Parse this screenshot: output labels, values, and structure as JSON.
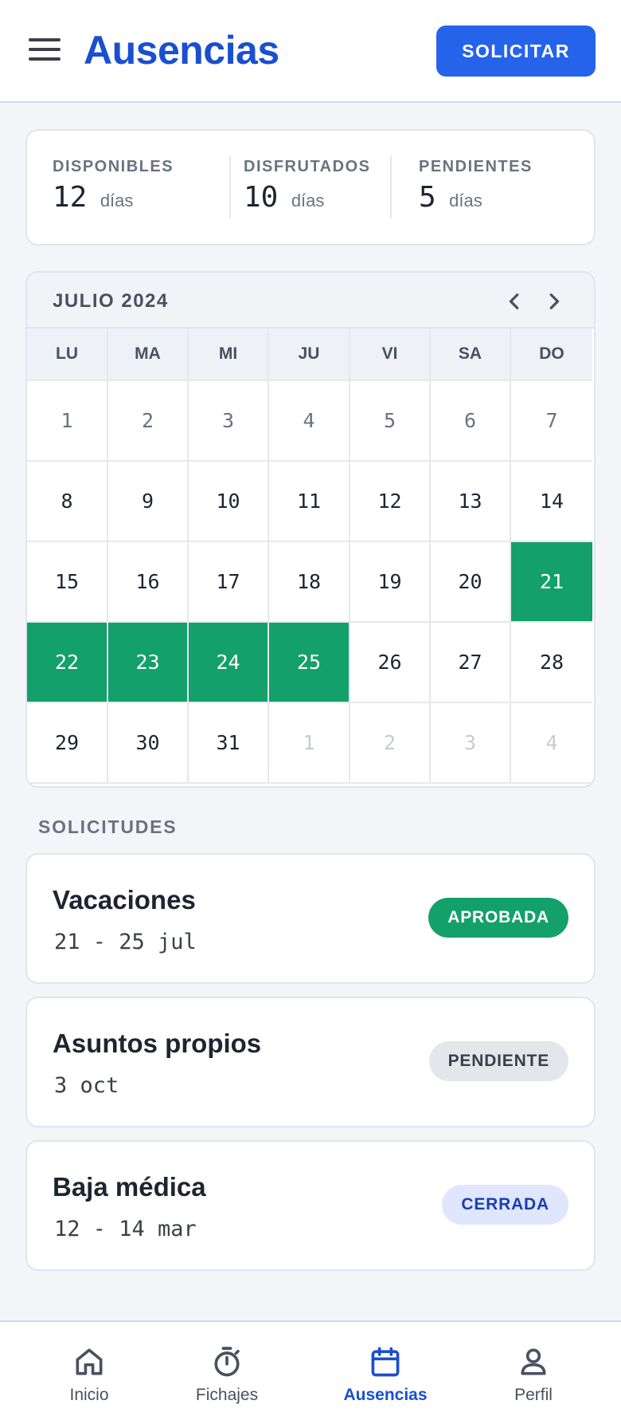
{
  "header": {
    "title": "Ausencias",
    "action_label": "SOLICITAR"
  },
  "stats": [
    {
      "label": "DISPONIBLES",
      "value": "12",
      "unit": "días"
    },
    {
      "label": "DISFRUTADOS",
      "value": "10",
      "unit": "días"
    },
    {
      "label": "PENDIENTES",
      "value": "5",
      "unit": "días"
    }
  ],
  "calendar": {
    "month_label": "JULIO 2024",
    "weekdays": [
      "LU",
      "MA",
      "MI",
      "JU",
      "VI",
      "SA",
      "DO"
    ],
    "weeks": [
      [
        "1",
        "2",
        "3",
        "4",
        "5",
        "6",
        "7"
      ],
      [
        "8",
        "9",
        "10",
        "11",
        "12",
        "13",
        "14"
      ],
      [
        "15",
        "16",
        "17",
        "18",
        "19",
        "20",
        "21"
      ],
      [
        "22",
        "23",
        "24",
        "25",
        "26",
        "27",
        "28"
      ],
      [
        "29",
        "30",
        "31",
        "1",
        "2",
        "3",
        "4"
      ]
    ],
    "selected_color": "#13a06b"
  },
  "requests": {
    "section_title": "SOLICITUDES",
    "items": [
      {
        "type": "Vacaciones",
        "dates": "21 - 25 jul",
        "status": "APROBADA",
        "badge_bg": "#13a06b",
        "badge_fg": "#ffffff"
      },
      {
        "type": "Asuntos propios",
        "dates": "3 oct",
        "status": "PENDIENTE",
        "badge_bg": "#e3e6eb",
        "badge_fg": "#3b3f48"
      },
      {
        "type": "Baja médica",
        "dates": "12 - 14 mar",
        "status": "CERRADA",
        "badge_bg": "#dfe6fd",
        "badge_fg": "#1a3fb0"
      }
    ]
  },
  "bottom_nav": {
    "items": [
      {
        "label": "Inicio",
        "icon": "home-icon"
      },
      {
        "label": "Fichajes",
        "icon": "stopwatch-icon"
      },
      {
        "label": "Ausencias",
        "icon": "calendar-icon",
        "active": true
      },
      {
        "label": "Perfil",
        "icon": "person-icon"
      }
    ]
  }
}
